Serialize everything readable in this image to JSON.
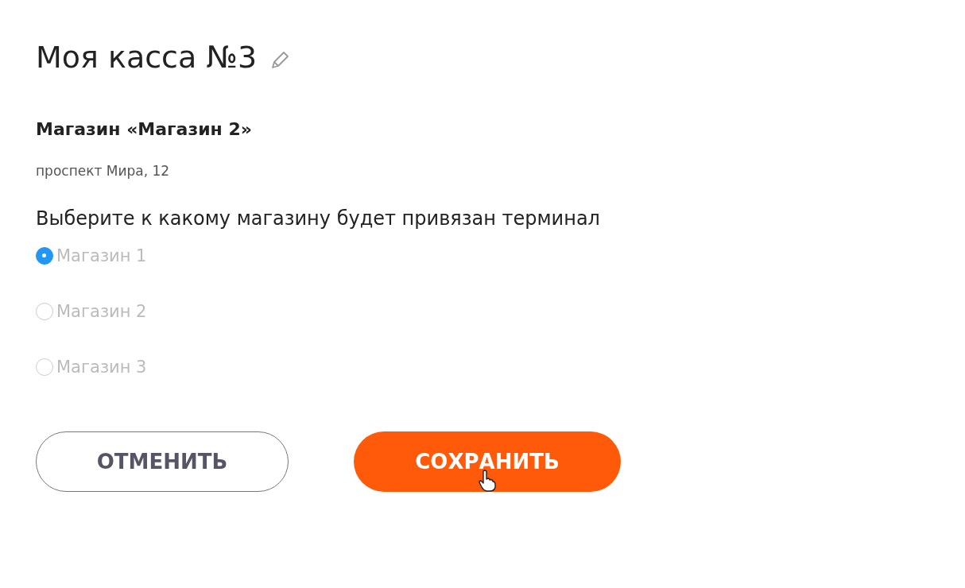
{
  "title": "Моя касса №3",
  "store": {
    "name": "Магазин «Магазин 2»",
    "address": "проспект Мира, 12"
  },
  "question": "Выберите к какому магазину будет привязан терминал",
  "options": [
    {
      "label": "Магазин 1",
      "selected": true
    },
    {
      "label": "Магазин 2",
      "selected": false
    },
    {
      "label": "Магазин 3",
      "selected": false
    }
  ],
  "buttons": [
    {
      "label": "ОТМЕНИТЬ",
      "kind": "secondary"
    },
    {
      "label": "СОХРАНИТЬ",
      "kind": "primary"
    }
  ]
}
